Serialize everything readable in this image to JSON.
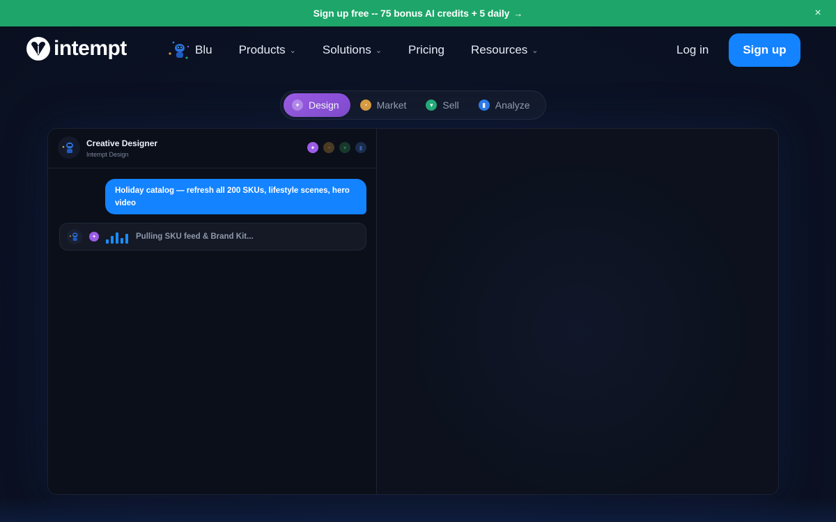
{
  "banner": {
    "text": "Sign up free -- 75 bonus AI credits + 5 daily",
    "arrow": "→",
    "close": "×"
  },
  "nav": {
    "logo_text": "intempt",
    "blu_label": "Blu",
    "products_label": "Products",
    "solutions_label": "Solutions",
    "pricing_label": "Pricing",
    "resources_label": "Resources",
    "chevron": "⌄",
    "login_label": "Log in",
    "signup_label": "Sign up"
  },
  "tabs": [
    {
      "label": "Design",
      "active": true,
      "color": "#9b5de5"
    },
    {
      "label": "Market",
      "active": false,
      "color": "#e0a040"
    },
    {
      "label": "Sell",
      "active": false,
      "color": "#27b07a"
    },
    {
      "label": "Analyze",
      "active": false,
      "color": "#2f7ff0"
    }
  ],
  "chat": {
    "agent_title": "Creative Designer",
    "agent_subtitle": "Intempt Design",
    "user_message": "Holiday catalog — refresh all 200 SKUs, lifestyle scenes, hero video",
    "status_text": "Pulling SKU feed & Brand Kit..."
  },
  "colors": {
    "banner": "#1ea66a",
    "accent": "#1483ff",
    "design": "#9b5de5",
    "market": "#e0a040",
    "sell": "#27b07a",
    "analyze": "#2f7ff0"
  }
}
